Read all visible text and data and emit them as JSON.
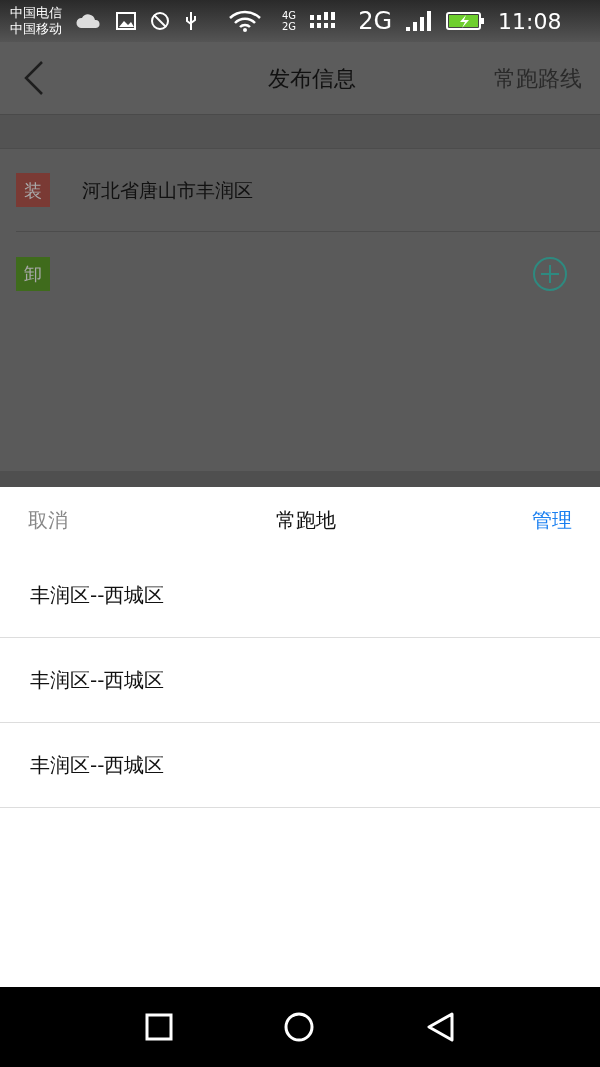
{
  "status_bar": {
    "carriers": [
      "中国电信",
      "中国移动"
    ],
    "net_small": [
      "4G",
      "2G"
    ],
    "net_big": "2G",
    "time": "11:08"
  },
  "header": {
    "title": "发布信息",
    "action": "常跑路线"
  },
  "stops": [
    {
      "tag": "装",
      "color": "#7a3a34",
      "address": "河北省唐山市丰润区",
      "add_button": false
    },
    {
      "tag": "卸",
      "color": "#3f6b1c",
      "add_button": true
    }
  ],
  "sheet": {
    "cancel": "取消",
    "title": "常跑地",
    "manage": "管理",
    "items": [
      "丰润区--西城区",
      "丰润区--西城区",
      "丰润区--西城区"
    ]
  }
}
